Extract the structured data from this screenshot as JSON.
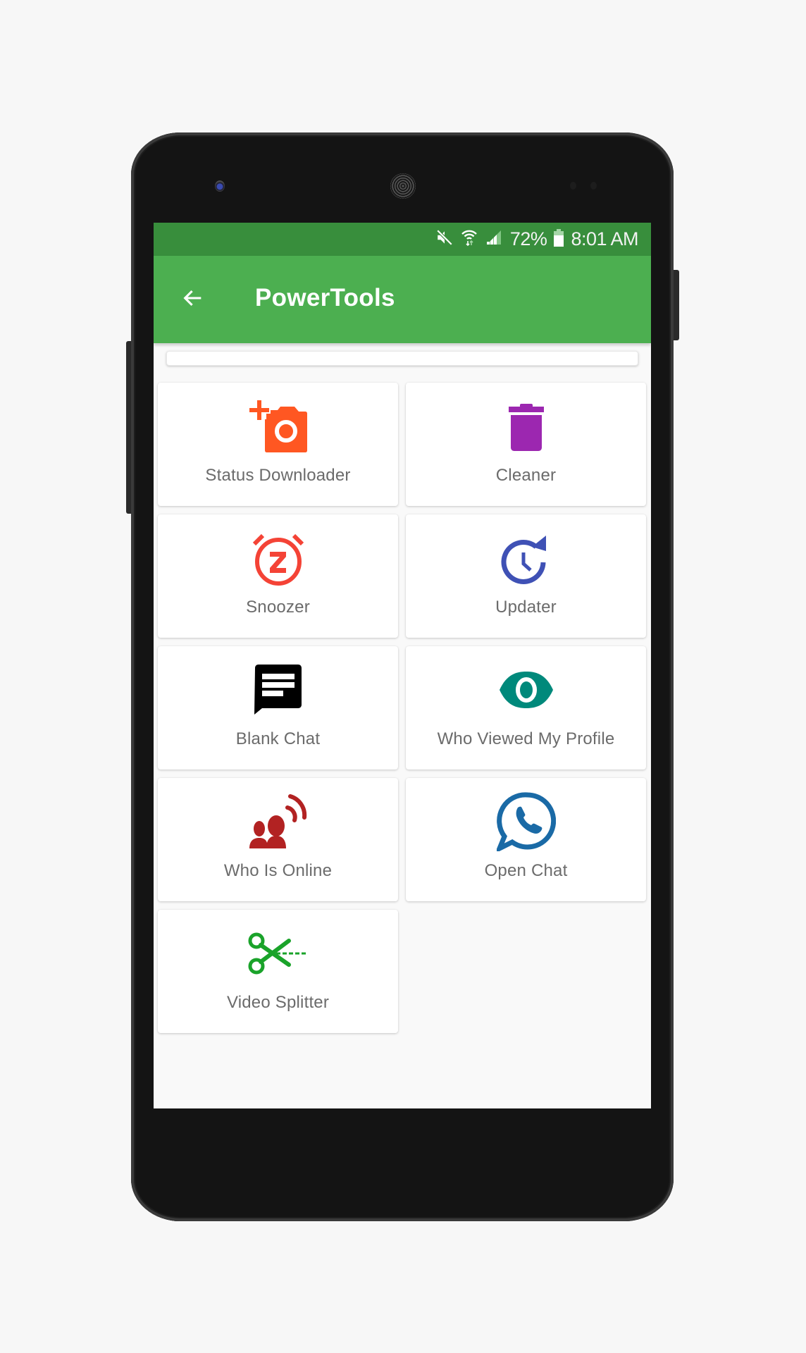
{
  "status_bar": {
    "icons": [
      "mute-icon",
      "wifi-icon",
      "signal-icon",
      "battery-icon"
    ],
    "battery_percent": "72%",
    "time": "8:01 AM"
  },
  "toolbar": {
    "back_icon": "arrow-left-icon",
    "title": "PowerTools"
  },
  "colors": {
    "status_bar": "#388e3c",
    "toolbar": "#4caf50",
    "status_downloader": "#ff5722",
    "cleaner": "#9c27b0",
    "snoozer": "#f44336",
    "updater": "#3f51b5",
    "blank_chat": "#000000",
    "who_viewed": "#00897b",
    "who_online": "#b22222",
    "open_chat": "#1a6aa6",
    "video_splitter": "#1aa32a"
  },
  "tools": [
    {
      "label": "Status Downloader",
      "icon": "add-a-photo-icon"
    },
    {
      "label": "Cleaner",
      "icon": "trash-icon"
    },
    {
      "label": "Snoozer",
      "icon": "snooze-alarm-icon"
    },
    {
      "label": "Updater",
      "icon": "update-clock-icon"
    },
    {
      "label": "Blank Chat",
      "icon": "chat-bubble-icon"
    },
    {
      "label": "Who Viewed My Profile",
      "icon": "eye-icon"
    },
    {
      "label": "Who Is Online",
      "icon": "people-online-icon"
    },
    {
      "label": "Open Chat",
      "icon": "whatsapp-icon"
    },
    {
      "label": "Video Splitter",
      "icon": "scissors-icon"
    }
  ]
}
